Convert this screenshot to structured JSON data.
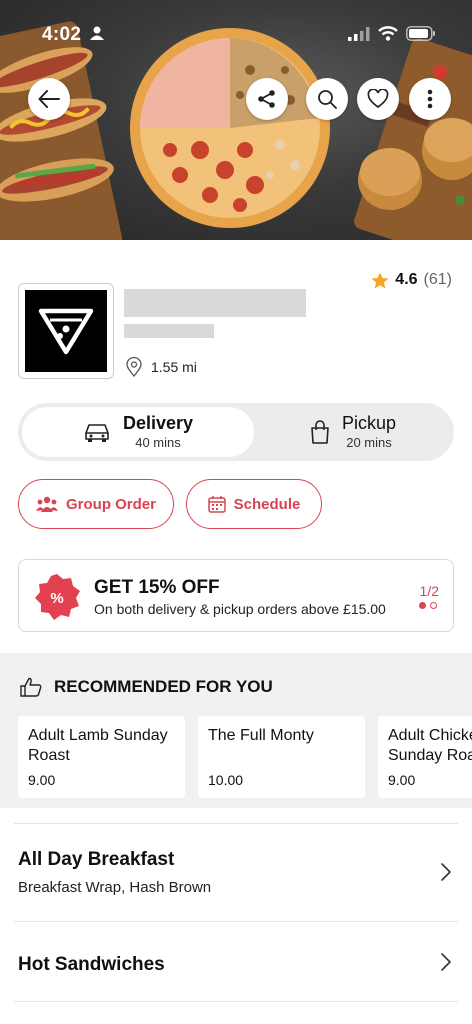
{
  "status_bar": {
    "time": "4:02"
  },
  "store": {
    "rating_score": "4.6",
    "rating_count": "(61)",
    "distance": "1.55 mi"
  },
  "fulfillment": {
    "delivery": {
      "label": "Delivery",
      "time": "40 mins"
    },
    "pickup": {
      "label": "Pickup",
      "time": "20 mins"
    }
  },
  "actions": {
    "group_order": "Group Order",
    "schedule": "Schedule"
  },
  "promo": {
    "badge": "%",
    "title": "GET 15% OFF",
    "description": "On both delivery & pickup orders above £15.00",
    "page": "1/2"
  },
  "recommended": {
    "heading": "RECOMMENDED FOR YOU",
    "items": [
      {
        "name": "Adult Lamb Sunday Roast",
        "price": "9.00"
      },
      {
        "name": "The Full Monty",
        "price": "10.00"
      },
      {
        "name": "Adult Chicken Sunday Roast",
        "price": "9.00"
      }
    ]
  },
  "categories": [
    {
      "title": "All Day Breakfast",
      "subtitle": "Breakfast Wrap, Hash Brown"
    },
    {
      "title": "Hot Sandwiches",
      "subtitle": ""
    }
  ],
  "colors": {
    "accent": "#d94452",
    "star": "#f5a623"
  }
}
